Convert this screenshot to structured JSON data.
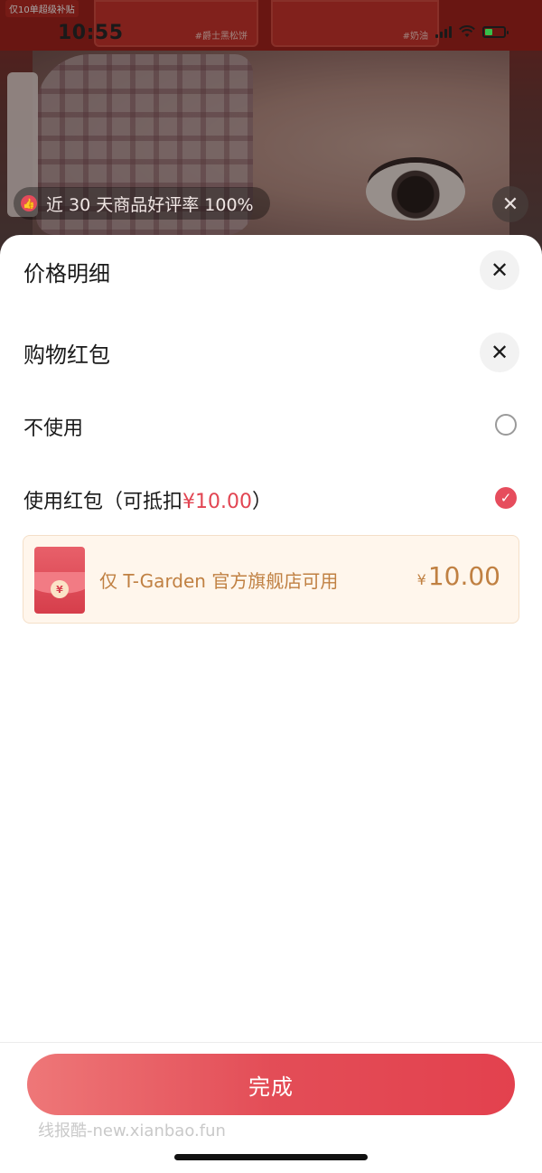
{
  "status_bar": {
    "time": "10:55"
  },
  "banner": {
    "rating_text": "近 30 天商品好评率 100%",
    "tiles": [
      "#爵士黑松饼",
      "#奶油"
    ],
    "red_tag": "仅10单超级补贴"
  },
  "sheet": {
    "price_detail_title": "价格明细",
    "red_packet_title": "购物红包",
    "option_none": "不使用",
    "option_use_prefix": "使用红包（可抵扣",
    "option_use_amount": "¥10.00",
    "option_use_suffix": "）",
    "coupon": {
      "label": "仅 T-Garden 官方旗舰店可用",
      "currency": "¥",
      "amount": "10.00",
      "coin_symbol": "¥"
    },
    "done_button": "完成"
  },
  "watermark": "线报酷-new.xianbao.fun",
  "colors": {
    "accent": "#e24552",
    "coupon_text": "#c08042",
    "coupon_bg": "#fff6ec"
  },
  "icons": {
    "close": "close-icon",
    "thumb": "thumb-up-icon",
    "check": "check-icon"
  }
}
